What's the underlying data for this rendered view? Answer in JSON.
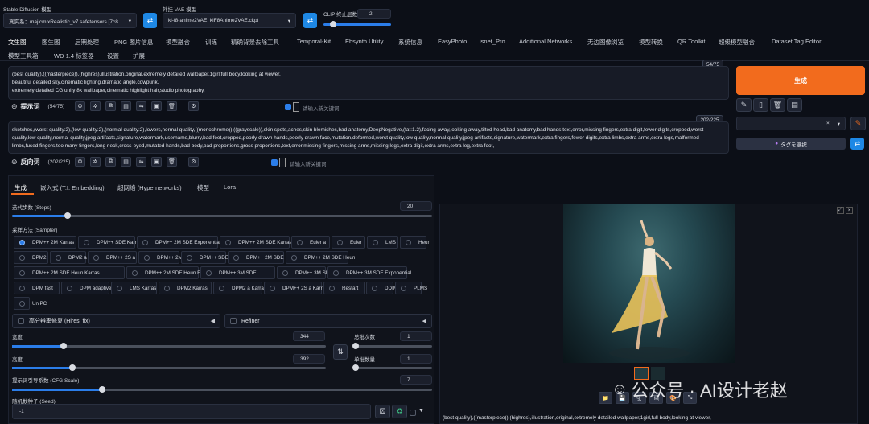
{
  "top": {
    "sd_model_label": "Stable Diffusion 模型",
    "sd_model_value": "真实系：majicmixRealistic_v7.safetensors [7c8",
    "vae_label": "外挂 VAE 模型",
    "vae_value": "kl-f8-anime2VAE_klF8Anime2VAE.ckpt",
    "clip_label": "CLIP 终止层数",
    "clip_value": "2"
  },
  "tabs_row1": [
    "文生图",
    "图生图",
    "后期处理",
    "PNG 图片信息",
    "模型融合",
    "训练",
    "精确背景去除工具",
    "Temporal-Kit",
    "Ebsynth Utility",
    "系统信息",
    "EasyPhoto",
    "isnet_Pro",
    "Additional Networks",
    "无边图像浏览",
    "模型转换",
    "QR Toolkit",
    "超级模型融合",
    "Dataset Tag Editor"
  ],
  "tabs_row2": [
    "模型工具箱",
    "WD 1.4 标签器",
    "设置",
    "扩展"
  ],
  "prompt": {
    "text": "(best quality),((masterpiece)),(highres),illustration,original,extremely detailed wallpaper,1girl,full body,looking at viewer,\nbeautiful detailed sky,cinematic lighting,dramatic angle,cowpunk,\nextremely detailed CG unity 8k wallpaper,cinematic highlight hair,studio photography,",
    "counter": "54/75",
    "label": "提示词",
    "count": "(54/75)",
    "new_kw_placeholder": "请输入新关键词"
  },
  "negative": {
    "text": "sketches,(worst quality:2),(low quality:2),(normal quality:2),lowers,normal quality,((monochrome)),((grayscale)),skin spots,acnes,skin blemishes,bad anatomy,DeepNegative,(fat:1.2),facing away,looking away,tilted head,bad anatomy,bad hands,text,error,missing fingers,extra digit,fewer digits,cropped,worst quality,low quality,normal quality,jpeg artifacts,signature,watermark,username,blurry,bad feet,cropped,poorly drawn hands,poorly drawn face,mutation,deformed,worst quality,low quality,normal quality,jpeg artifacts,signature,watermark,extra fingers,fewer digits,extra limbs,extra arms,extra legs,malformed limbs,fused fingers,too many fingers,long neck,cross-eyed,mutated hands,bad body,bad proportions,gross proportions,text,error,missing fingers,missing arms,missing legs,extra digit,extra arms,extra leg,extra foot,",
    "counter": "202/225",
    "label": "反向词",
    "count": "(202/225)",
    "new_kw_placeholder": "请输入新关键词"
  },
  "right": {
    "generate": "生成",
    "tag_select": "タグを選択"
  },
  "subtabs": [
    "生成",
    "嵌入式 (T.I. Embedding)",
    "超网络 (Hypernetworks)",
    "模型",
    "Lora"
  ],
  "steps": {
    "label": "迭代步数 (Steps)",
    "value": "20"
  },
  "sampler": {
    "label": "采样方法 (Sampler)",
    "options": [
      "DPM++ 2M Karras",
      "DPM++ SDE Karras",
      "DPM++ 2M SDE Exponential",
      "DPM++ 2M SDE Karras",
      "Euler a",
      "Euler",
      "LMS",
      "Heun",
      "DPM2",
      "DPM2 a",
      "DPM++ 2S a",
      "DPM++ 2M",
      "DPM++ SDE",
      "DPM++ 2M SDE",
      "DPM++ 2M SDE Heun",
      "DPM++ 2M SDE Heun Karras",
      "DPM++ 2M SDE Heun Exponential",
      "DPM++ 3M SDE",
      "DPM++ 3M SDE Karras",
      "DPM++ 3M SDE Exponential",
      "DPM fast",
      "DPM adaptive",
      "LMS Karras",
      "DPM2 Karras",
      "DPM2 a Karras",
      "DPM++ 2S a Karras",
      "Restart",
      "DDIM",
      "PLMS",
      "UniPC"
    ]
  },
  "hires": {
    "label": "高分辨率修复 (Hires. fix)"
  },
  "refiner": {
    "label": "Refiner"
  },
  "width": {
    "label": "宽度",
    "value": "344"
  },
  "height": {
    "label": "高度",
    "value": "392"
  },
  "batch_count": {
    "label": "总批次数",
    "value": "1"
  },
  "batch_size": {
    "label": "单批数量",
    "value": "1"
  },
  "cfg": {
    "label": "提示词引导系数 (CFG Scale)",
    "value": "7"
  },
  "seed": {
    "label": "随机数种子 (Seed)",
    "value": "-1"
  },
  "output": {
    "caption": "(best quality),((masterpiece)),(highres),illustration,original,extremely detailed wallpaper,1girl,full body,looking at viewer,"
  },
  "watermark": "公众号 · AI设计老赵",
  "colors": {
    "accent": "#f26b1d",
    "blue": "#1e88e5",
    "bg": "#0c0f17"
  }
}
